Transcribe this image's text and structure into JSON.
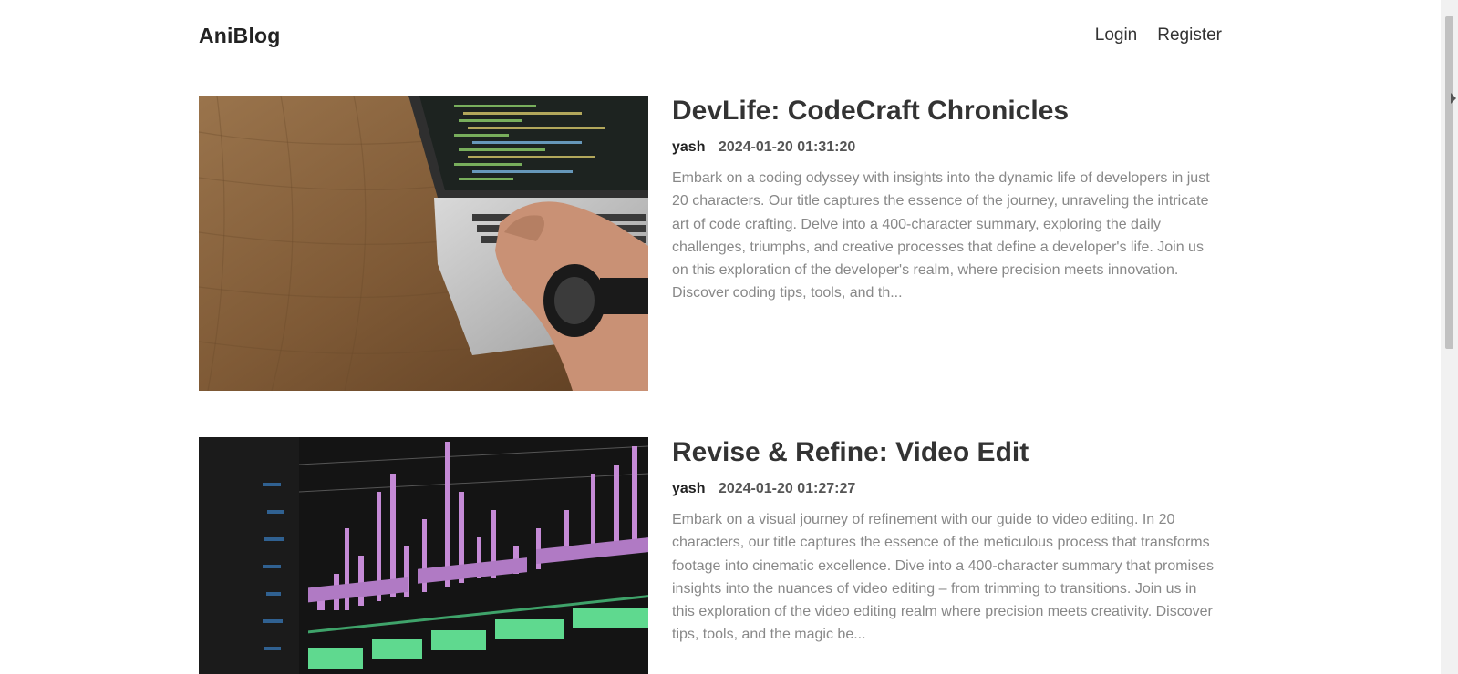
{
  "header": {
    "brand": "AniBlog",
    "nav": [
      {
        "label": "Login"
      },
      {
        "label": "Register"
      }
    ]
  },
  "posts": [
    {
      "title": "DevLife: CodeCraft Chronicles",
      "author": "yash",
      "date": "2024-01-20 01:31:20",
      "excerpt": "Embark on a coding odyssey with insights into the dynamic life of developers in just 20 characters. Our title captures the essence of the journey, unraveling the intricate art of code crafting. Delve into a 400-character summary, exploring the daily challenges, triumphs, and creative processes that define a developer's life. Join us on this exploration of the developer's realm, where precision meets innovation. Discover coding tips, tools, and th...",
      "image": "laptop-coding-photo"
    },
    {
      "title": "Revise & Refine: Video Edit",
      "author": "yash",
      "date": "2024-01-20 01:27:27",
      "excerpt": "Embark on a visual journey of refinement with our guide to video editing. In 20 characters, our title captures the essence of the meticulous process that transforms footage into cinematic excellence. Dive into a 400-character summary that promises insights into the nuances of video editing – from trimming to transitions. Join us in this exploration of the video editing realm where precision meets creativity. Discover tips, tools, and the magic be...",
      "image": "video-editing-timeline-photo"
    }
  ],
  "colors": {
    "title": "#333333",
    "excerpt": "#888888",
    "wood": "#8a6440",
    "timeline_purple": "#c58ad6",
    "timeline_green": "#5fd98f"
  }
}
